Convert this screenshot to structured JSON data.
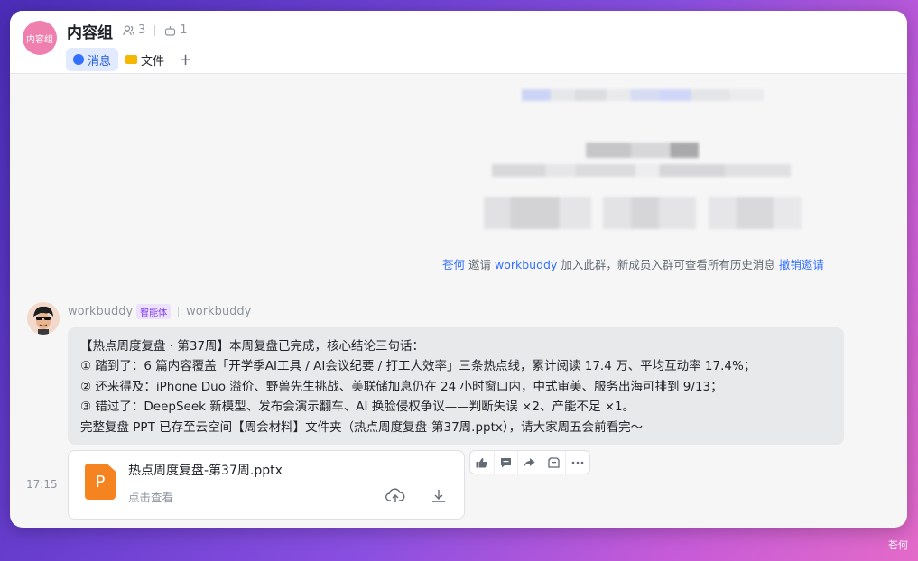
{
  "header": {
    "avatar_text": "内容组",
    "title": "内容组",
    "member_count": "3",
    "bot_count": "1",
    "tabs": [
      {
        "label": "消息",
        "icon": "chat-bubble-icon",
        "active": true
      },
      {
        "label": "文件",
        "icon": "folder-icon",
        "active": false
      }
    ],
    "add_tab": "+"
  },
  "system_message": {
    "inviter": "苍何",
    "verb": "邀请",
    "invitee": "workbuddy",
    "text": "加入此群，新成员入群可查看所有历史消息",
    "revoke": "撤销邀请"
  },
  "message": {
    "sender": "workbuddy",
    "badge": "智能体",
    "sender_alias": "workbuddy",
    "time": "17:15",
    "lines": [
      "【热点周度复盘 · 第37周】本周复盘已完成，核心结论三句话：",
      "① 踏到了：6 篇内容覆盖「开学季AI工具 / AI会议纪要 / 打工人效率」三条热点线，累计阅读 17.4 万、平均互动率 17.4%；",
      "② 还来得及：iPhone Duo 溢价、野兽先生挑战、美联储加息仍在 24 小时窗口内，中式审美、服务出海可排到 9/13；",
      "③ 错过了：DeepSeek 新模型、发布会演示翻车、AI 换脸侵权争议——判断失误 ×2、产能不足 ×1。",
      "完整复盘 PPT 已存至云空间【周会材料】文件夹（热点周度复盘-第37周.pptx），请大家周五会前看完～"
    ],
    "attachment": {
      "icon_letter": "P",
      "name": "热点周度复盘-第37周.pptx",
      "action_hint": "点击查看"
    },
    "toolbar": [
      "thumbs-up-icon",
      "comment-icon",
      "forward-icon",
      "save-icon",
      "more-icon"
    ]
  },
  "corner_label": "苍何",
  "colors": {
    "accent": "#3370ff",
    "ppt": "#f5831f",
    "badge": "#7f3bf5"
  }
}
